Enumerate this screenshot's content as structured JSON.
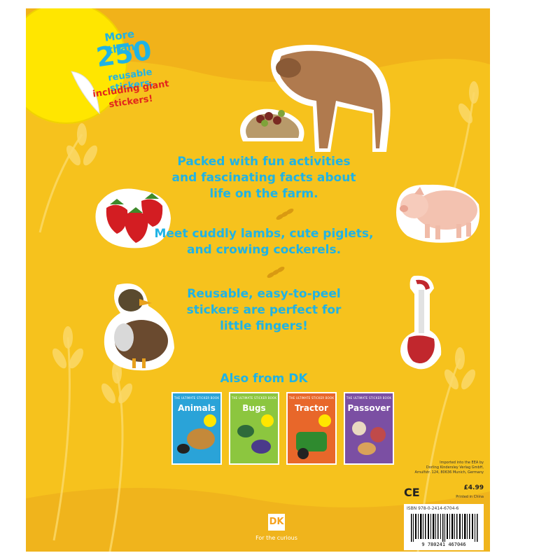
{
  "sticker_badge": {
    "line1": "More than",
    "number": "250",
    "line2": "reusable stickers,",
    "line3": "including giant",
    "line4": "stickers!"
  },
  "blurbs": [
    {
      "line1": "Packed with fun activities",
      "line2": "and fascinating facts about",
      "line3": "life on the farm."
    },
    {
      "line1": "Meet cuddly lambs, cute piglets,",
      "line2": "and crowing cockerels.",
      "line3": ""
    },
    {
      "line1": "Reusable, easy-to-peel",
      "line2": "stickers are perfect for",
      "line3": "little fingers!"
    }
  ],
  "also_from": "Also from DK",
  "books": [
    {
      "series": "THE ULTIMATE STICKER BOOK",
      "title": "Animals",
      "color": "#2aa3d8",
      "badge": "250"
    },
    {
      "series": "THE ULTIMATE STICKER BOOK",
      "title": "Bugs",
      "color": "#8cc63f",
      "badge": "250"
    },
    {
      "series": "THE ULTIMATE STICKER BOOK",
      "title": "Tractor",
      "color": "#e8672a",
      "badge": "250"
    },
    {
      "series": "THE ULTIMATE STICKER BOOK",
      "title": "Passover",
      "color": "#7b4fa3",
      "badge": ""
    }
  ],
  "imprint": {
    "line1": "Imported into the EEA by",
    "line2": "Dorling Kindersley Verlag GmbH,",
    "line3": "Arnulfstr. 124, 80636 Munich, Germany",
    "ce": "CE",
    "price": "£4.99",
    "printed": "Printed in China",
    "isbn": "ISBN 978-0-2414-6704-6",
    "barcode_digits": "9 780241 467046"
  },
  "publisher": {
    "logo": "DK",
    "tagline": "For the curious"
  },
  "colors": {
    "background": "#f6c21d",
    "text_blue": "#1fb3e5",
    "badge_yellow": "#ffe600"
  }
}
